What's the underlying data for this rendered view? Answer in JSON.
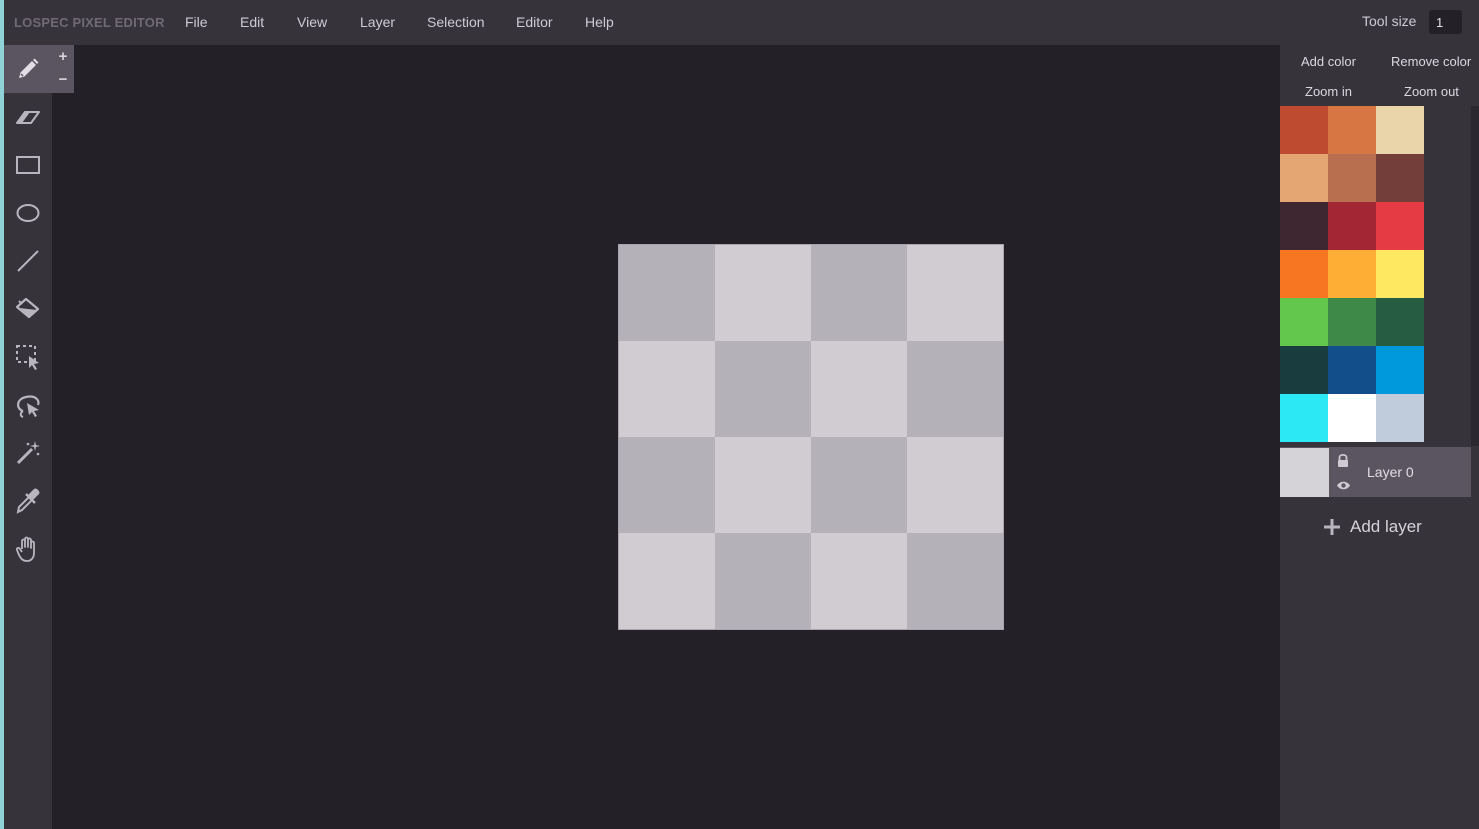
{
  "app": {
    "title": "LOSPEC PIXEL EDITOR"
  },
  "menu": [
    "File",
    "Edit",
    "View",
    "Layer",
    "Selection",
    "Editor",
    "Help"
  ],
  "tool_size": {
    "label": "Tool size",
    "value": "1"
  },
  "tools": [
    {
      "name": "pencil-tool",
      "icon": "pencil-icon",
      "active": true
    },
    {
      "name": "eraser-tool",
      "icon": "eraser-icon"
    },
    {
      "name": "rectangle-tool",
      "icon": "rectangle-icon"
    },
    {
      "name": "ellipse-tool",
      "icon": "ellipse-icon"
    },
    {
      "name": "line-tool",
      "icon": "line-icon"
    },
    {
      "name": "fill-tool",
      "icon": "paint-bucket-icon"
    },
    {
      "name": "rect-select-tool",
      "icon": "rectangle-select-icon"
    },
    {
      "name": "lasso-tool",
      "icon": "lasso-icon"
    },
    {
      "name": "magic-wand-tool",
      "icon": "magic-wand-icon"
    },
    {
      "name": "eyedropper-tool",
      "icon": "eyedropper-icon"
    },
    {
      "name": "pan-tool",
      "icon": "hand-icon"
    }
  ],
  "size_controls": {
    "increase": "+",
    "decrease": "−"
  },
  "palette_controls": {
    "add_color": "Add color",
    "remove_color": "Remove color",
    "zoom_in": "Zoom in",
    "zoom_out": "Zoom out"
  },
  "palette": [
    "#be4a2f",
    "#d77643",
    "#ead4aa",
    "#e4a672",
    "#b86f50",
    "#733e39",
    "#3e2731",
    "#a22633",
    "#e43b44",
    "#f77622",
    "#feae34",
    "#fee761",
    "#63c74d",
    "#3e8948",
    "#265c42",
    "#193c3e",
    "#124e89",
    "#0099db",
    "#2ce8f5",
    "#ffffff",
    "#c0cbdc"
  ],
  "layers": [
    {
      "name": "Layer 0"
    }
  ],
  "add_layer": {
    "label": "Add layer"
  },
  "colors": {
    "background": "#232127",
    "panel": "#37333b",
    "active": "#5a5561",
    "checker_dark": "#b5b1b8",
    "checker_light": "#d0ccd1"
  }
}
